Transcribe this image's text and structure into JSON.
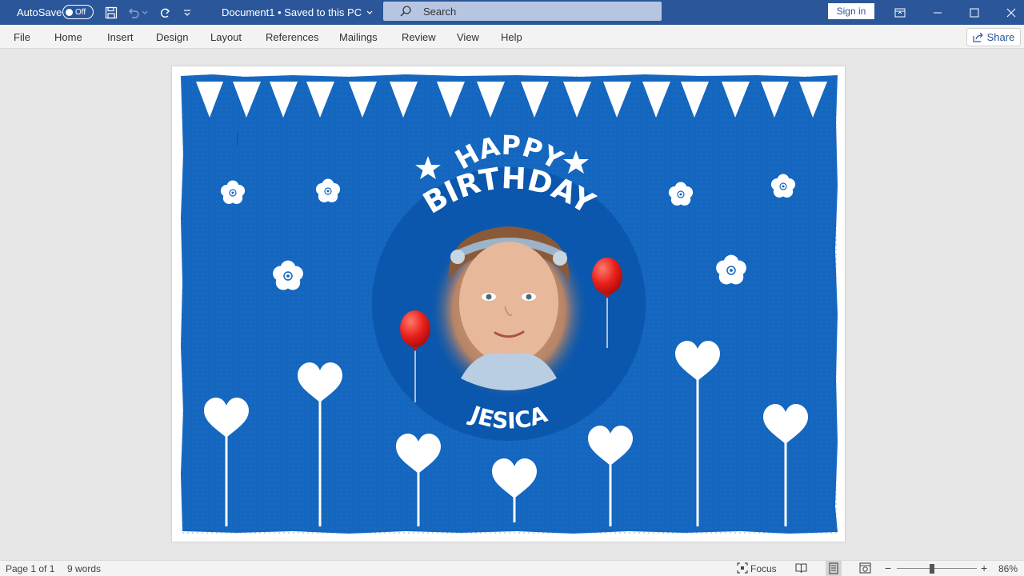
{
  "titlebar": {
    "autosave_label": "AutoSave",
    "autosave_state": "Off",
    "document_title": "Document1 • Saved to this PC",
    "search_label": "Search",
    "signin_label": "Sign in"
  },
  "ribbon": {
    "tabs": [
      "File",
      "Home",
      "Insert",
      "Design",
      "Layout",
      "References",
      "Mailings",
      "Review",
      "View",
      "Help"
    ],
    "share_label": "Share"
  },
  "card": {
    "line1": "HAPPY",
    "line2": "BIRTHDAY",
    "name": "JESICA"
  },
  "statusbar": {
    "page": "Page 1 of 1",
    "words": "9 words",
    "focus": "Focus",
    "zoom": "86%"
  },
  "colors": {
    "titlebar": "#2b579a",
    "card_bg": "#1466be",
    "circle": "#0a57ad",
    "balloon": "#e8201c"
  }
}
